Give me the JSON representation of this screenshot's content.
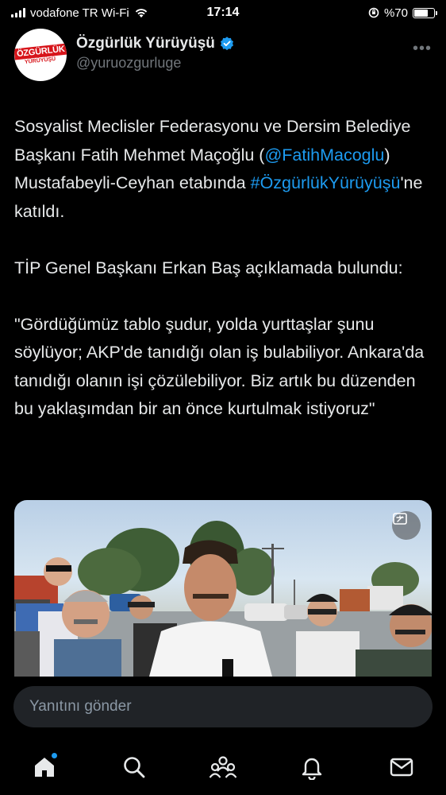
{
  "status_bar": {
    "carrier": "vodafone TR Wi-Fi",
    "time": "17:14",
    "battery_percent": "%70",
    "battery_level": 0.7
  },
  "author": {
    "name": "Özgürlük Yürüyüşü",
    "handle": "@yuruozgurluge",
    "verified": true,
    "avatar_text_line1": "ÖZGÜRLÜK",
    "avatar_text_line2": "YÜRÜYÜŞÜ"
  },
  "tweet": {
    "p1_a": "Sosyalist Meclisler Federasyonu ve Dersim Belediye Başkanı Fatih Mehmet Maçoğlu (",
    "p1_mention": "@FatihMacoglu",
    "p1_b": ") Mustafabeyli-Ceyhan etabında ",
    "p1_hashtag": "#ÖzgürlükYürüyüşü",
    "p1_c": "'ne katıldı.",
    "p2": "TİP Genel Başkanı Erkan Baş açıklamada bulundu:",
    "p3": "\"Gördüğümüz tablo şudur, yolda yurttaşlar şunu söylüyor; AKP'de tanıdığı olan iş bulabiliyor. Ankara'da tanıdığı olanın işi çözülebiliyor. Biz artık bu düzenden bu yaklaşımdan bir an önce kurtulmak istiyoruz\""
  },
  "reply": {
    "placeholder": "Yanıtını gönder"
  },
  "nav": {
    "items": [
      "home-icon",
      "search-icon",
      "communities-icon",
      "notifications-icon",
      "messages-icon"
    ]
  },
  "colors": {
    "accent": "#1d9bf0",
    "background": "#000000",
    "text": "#e7e9ea",
    "muted": "#71767b"
  }
}
